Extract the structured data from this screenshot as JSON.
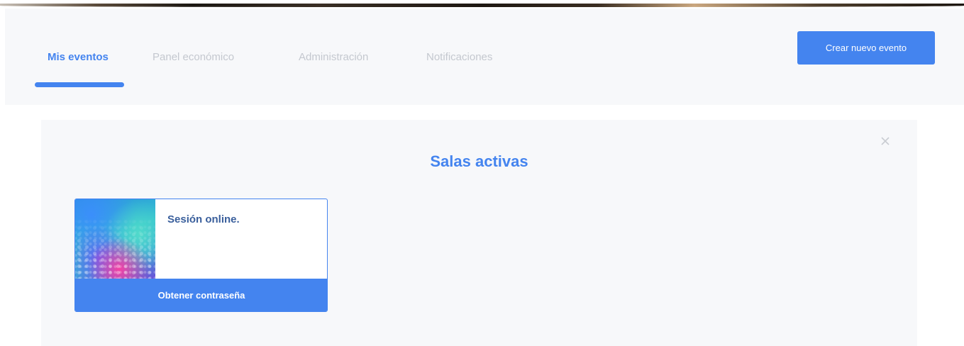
{
  "nav": {
    "tabs": [
      {
        "label": "Mis eventos",
        "active": true
      },
      {
        "label": "Panel económico",
        "active": false
      },
      {
        "label": "Administración",
        "active": false
      },
      {
        "label": "Notificaciones",
        "active": false
      }
    ],
    "create_button_label": "Crear nuevo evento"
  },
  "panel": {
    "title": "Salas activas",
    "close_icon": "close-icon",
    "rooms": [
      {
        "title": "Sesión online.",
        "thumbnail": "water-drops-image",
        "action_label": "Obtener contraseña"
      }
    ]
  },
  "colors": {
    "accent": "#4484ef",
    "inactive_tab": "#c4c8cf",
    "panel_bg": "#f7f8fa",
    "room_title": "#3a5f9c"
  }
}
